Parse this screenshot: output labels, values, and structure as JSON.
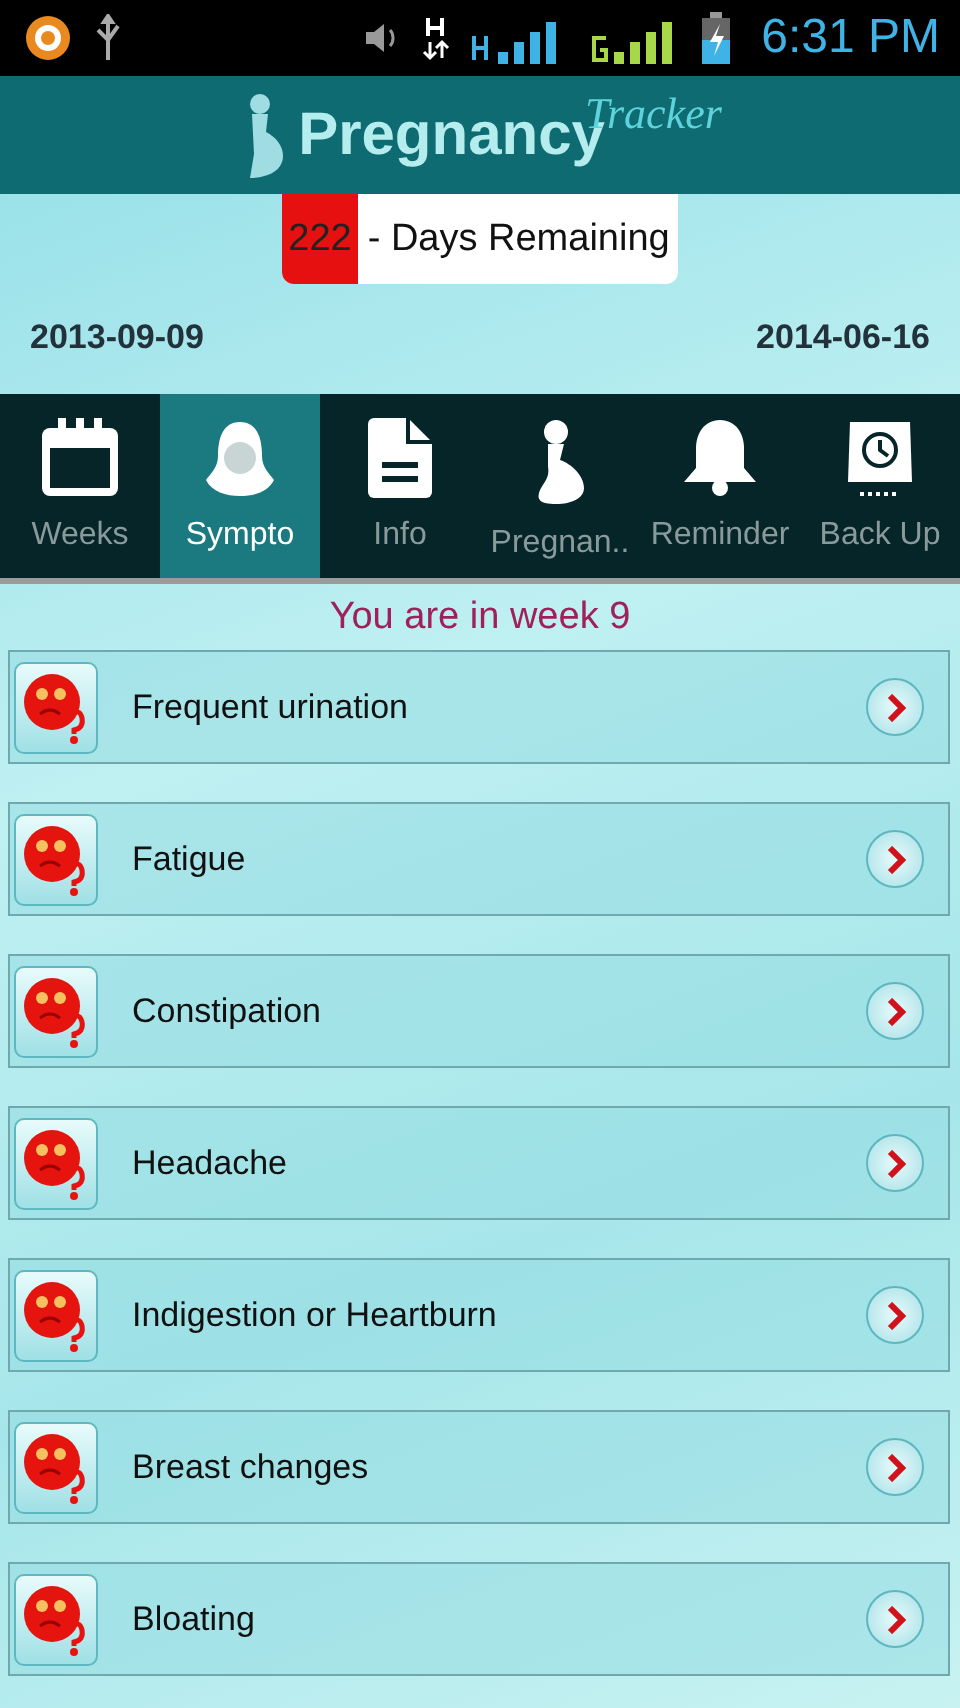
{
  "status_bar": {
    "time": "6:31 PM"
  },
  "header": {
    "logo_main": "Pregnancy",
    "logo_sub": "Tracker"
  },
  "countdown": {
    "days": "222",
    "label": "- Days Remaining"
  },
  "dates": {
    "start": "2013-09-09",
    "due": "2014-06-16"
  },
  "tabs": [
    {
      "label": "Weeks",
      "kind": "calendar",
      "selected": false
    },
    {
      "label": "Sympto",
      "kind": "woman",
      "selected": true
    },
    {
      "label": "Info",
      "kind": "document",
      "selected": false
    },
    {
      "label": "Pregnan..",
      "kind": "pregnant",
      "selected": false
    },
    {
      "label": "Reminder",
      "kind": "bell",
      "selected": false
    },
    {
      "label": "Back Up",
      "kind": "backup",
      "selected": false
    }
  ],
  "week_message": "You are in week 9",
  "symptoms": [
    {
      "label": "Frequent urination"
    },
    {
      "label": "Fatigue"
    },
    {
      "label": "Constipation"
    },
    {
      "label": "Headache"
    },
    {
      "label": "Indigestion or Heartburn"
    },
    {
      "label": "Breast changes"
    },
    {
      "label": "Bloating"
    }
  ]
}
